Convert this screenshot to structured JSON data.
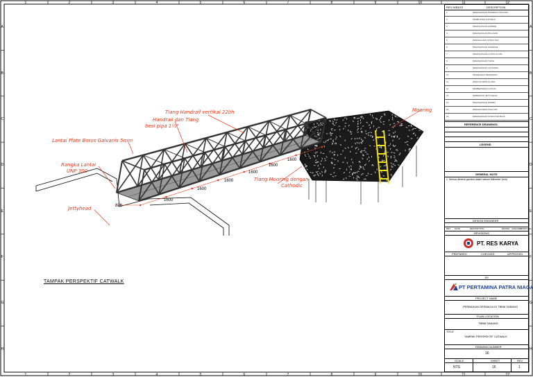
{
  "grid": {
    "columns": [
      "1",
      "2",
      "3",
      "4",
      "5",
      "6",
      "7",
      "8",
      "9",
      "10",
      "11",
      "12"
    ],
    "rows": [
      "A",
      "B",
      "C",
      "D",
      "E",
      "F",
      "G",
      "H"
    ]
  },
  "drawing": {
    "view_title": "TAMPAK PERSPEKTIF CATWALK",
    "annotations": {
      "handrail_post": "Tiang Handrail vertikal 22bh",
      "handrail_pipe_1": "Handrail dan Tiang",
      "handrail_pipe_2": "besi pipa 1½\"",
      "floor_plate": "Lantai Plate Boros Galvanis 5mm",
      "floor_frame_1": "Rangka Lantai",
      "floor_frame_2": "UNP 300",
      "jettyhead": "Jettyhead",
      "mooring": "Mooring",
      "mooring_post_1": "Tiang Mooring dengan",
      "mooring_post_2": "Cathodic"
    },
    "dimensions": [
      "1600",
      "1600",
      "1600",
      "1600",
      "1600",
      "1600",
      "1600",
      "826"
    ]
  },
  "title_block": {
    "rev_headers": [
      "REV NO",
      "DATE",
      "DESCRIPTION"
    ],
    "rev_rows": [
      "PEMASANGAN MOORING DOLPHIN",
      "PEMBUATAN CATWALK",
      "PEMASANGAN FENDER",
      "PEMASANGAN BOLLARD",
      "PENGECATAN STRUKTUR",
      "PEMASANGAN HANDRAIL",
      "PEMASANGAN LANTAI PLATE",
      "PEMASANGAN TIANG",
      "PEMASANGAN CATHODIC",
      "PEKERJAAN PERSIAPAN",
      "PENGUKURAN ULANG",
      "PEMBERSIHAN LOKASI",
      "PERBAIKAN JETTYHEAD",
      "PEMASANGAN RAMBU",
      "PENGECORAN PILE CAP",
      "PEMASANGAN STRUKTUR BAJA"
    ],
    "reference_drawings": "REFERENCE DRAWINGS",
    "legend": "LEGEND",
    "general_note": "GENERAL NOTE",
    "note_text": "1. Semua dimensi gambar dalam satuan Millimeter (mm)",
    "design_engineer": "DESIGN ENGINEER",
    "rev_table_cols": [
      "REV",
      "DATE",
      "DESCRIPTION",
      "DRAWN",
      "CHECKED",
      "APPROVED"
    ],
    "revisions_label": "REVISIONS",
    "company": "PT. RES KARYA",
    "approval_cols": [
      "PREPARED",
      "CHECKED",
      "APPROVED"
    ],
    "by_label": "BY",
    "client": "PT PERTAMINA PATRA NIAGA",
    "project_name_label": "PROJECT NAME",
    "project_name": "PERBAIKAN DERMAGA DI TBBM SABANG",
    "plan_location_label": "PLAN LOCATION",
    "plan_location": "TBBM SABANG",
    "title_label": "TITLE",
    "title": "TAMPAK PERSPEKTIF CATWALK",
    "drawing_number_label": "DRAWING NUMBER",
    "drawing_number": "16",
    "scale_label": "SCALE",
    "sheet_label": "SHEET",
    "rev_label": "REV",
    "scale": "NTS",
    "sheet": "16",
    "rev": "1"
  },
  "colors": {
    "annotation": "#e53b1c",
    "mooring_ladder": "#f2e21b",
    "line": "#000000"
  }
}
